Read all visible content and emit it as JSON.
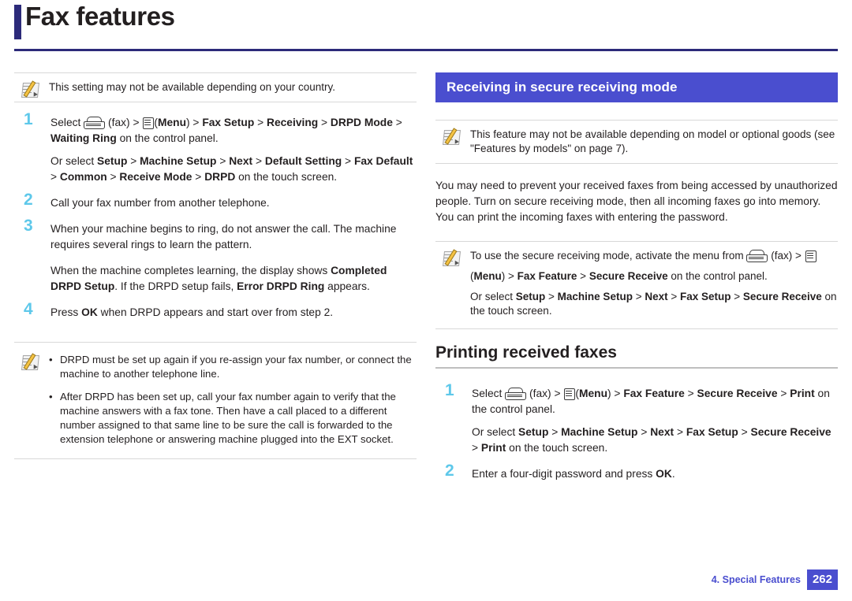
{
  "header": {
    "title": "Fax features"
  },
  "left": {
    "note_top": "This setting may not be available depending on your country.",
    "steps": [
      {
        "num": "1",
        "line1_pre": "Select ",
        "line1_fax": "(fax) > ",
        "line1_menu": "(",
        "line1_rest": "Menu) > Fax Setup > Receiving > DRPD Mode > Waiting Ring on the control panel.",
        "line2": "Or select Setup > Machine Setup > Next > Default Setting > Fax Default > Common > Receive Mode > DRPD on the touch screen."
      },
      {
        "num": "2",
        "text": "Call your fax number from another telephone."
      },
      {
        "num": "3",
        "text": "When your machine begins to ring, do not answer the call. The machine requires several rings to learn the pattern.",
        "text2": "When the machine completes learning, the display shows Completed DRPD Setup. If the DRPD setup fails, Error DRPD Ring appears."
      },
      {
        "num": "4",
        "text": "Press OK when DRPD appears and start over from step 2."
      }
    ],
    "bullets": [
      "DRPD must be set up again if you re-assign your fax number, or connect the machine to another telephone line.",
      "After DRPD has been set up, call your fax number again to verify that the machine answers with a fax tone. Then have a call placed to a different number assigned to that same line to be sure the call is forwarded to the extension telephone or answering machine plugged into the EXT socket."
    ]
  },
  "right": {
    "heading_secure": "Receiving in secure receiving mode",
    "note_models": "This feature may not be available depending on model or optional goods (see \"Features by models\" on page 7).",
    "paragraph": "You may need to prevent your received faxes from being accessed by unauthorized people. Turn on secure receiving mode, then all incoming faxes go into memory. You can print the incoming faxes with entering the password.",
    "note_secure_l1_pre": "To use the secure receiving mode, activate the menu from ",
    "note_secure_l1_fax": "(fax) > ",
    "note_secure_l2": "(Menu) > Fax Feature > Secure Receive on the control panel.",
    "note_secure_l3": "Or select Setup > Machine Setup > Next > Fax Setup > Secure Receive on the touch screen.",
    "heading_printing": "Printing received faxes",
    "steps": [
      {
        "num": "1",
        "line1_pre": "Select ",
        "line1_fax": "(fax) > ",
        "line1_rest": "(Menu) > Fax Feature > Secure Receive > Print on the control panel.",
        "line2": "Or select Setup > Machine Setup > Next > Fax Setup > Secure Receive > Print on the touch screen."
      },
      {
        "num": "2",
        "text": "Enter a four-digit password and press OK."
      }
    ]
  },
  "footer": {
    "chapter": "4. Special Features",
    "page": "262"
  },
  "colors": {
    "accent_blue": "#4a4ecf",
    "title_bar": "#2c2a7a",
    "step_number": "#5ec8ea"
  }
}
